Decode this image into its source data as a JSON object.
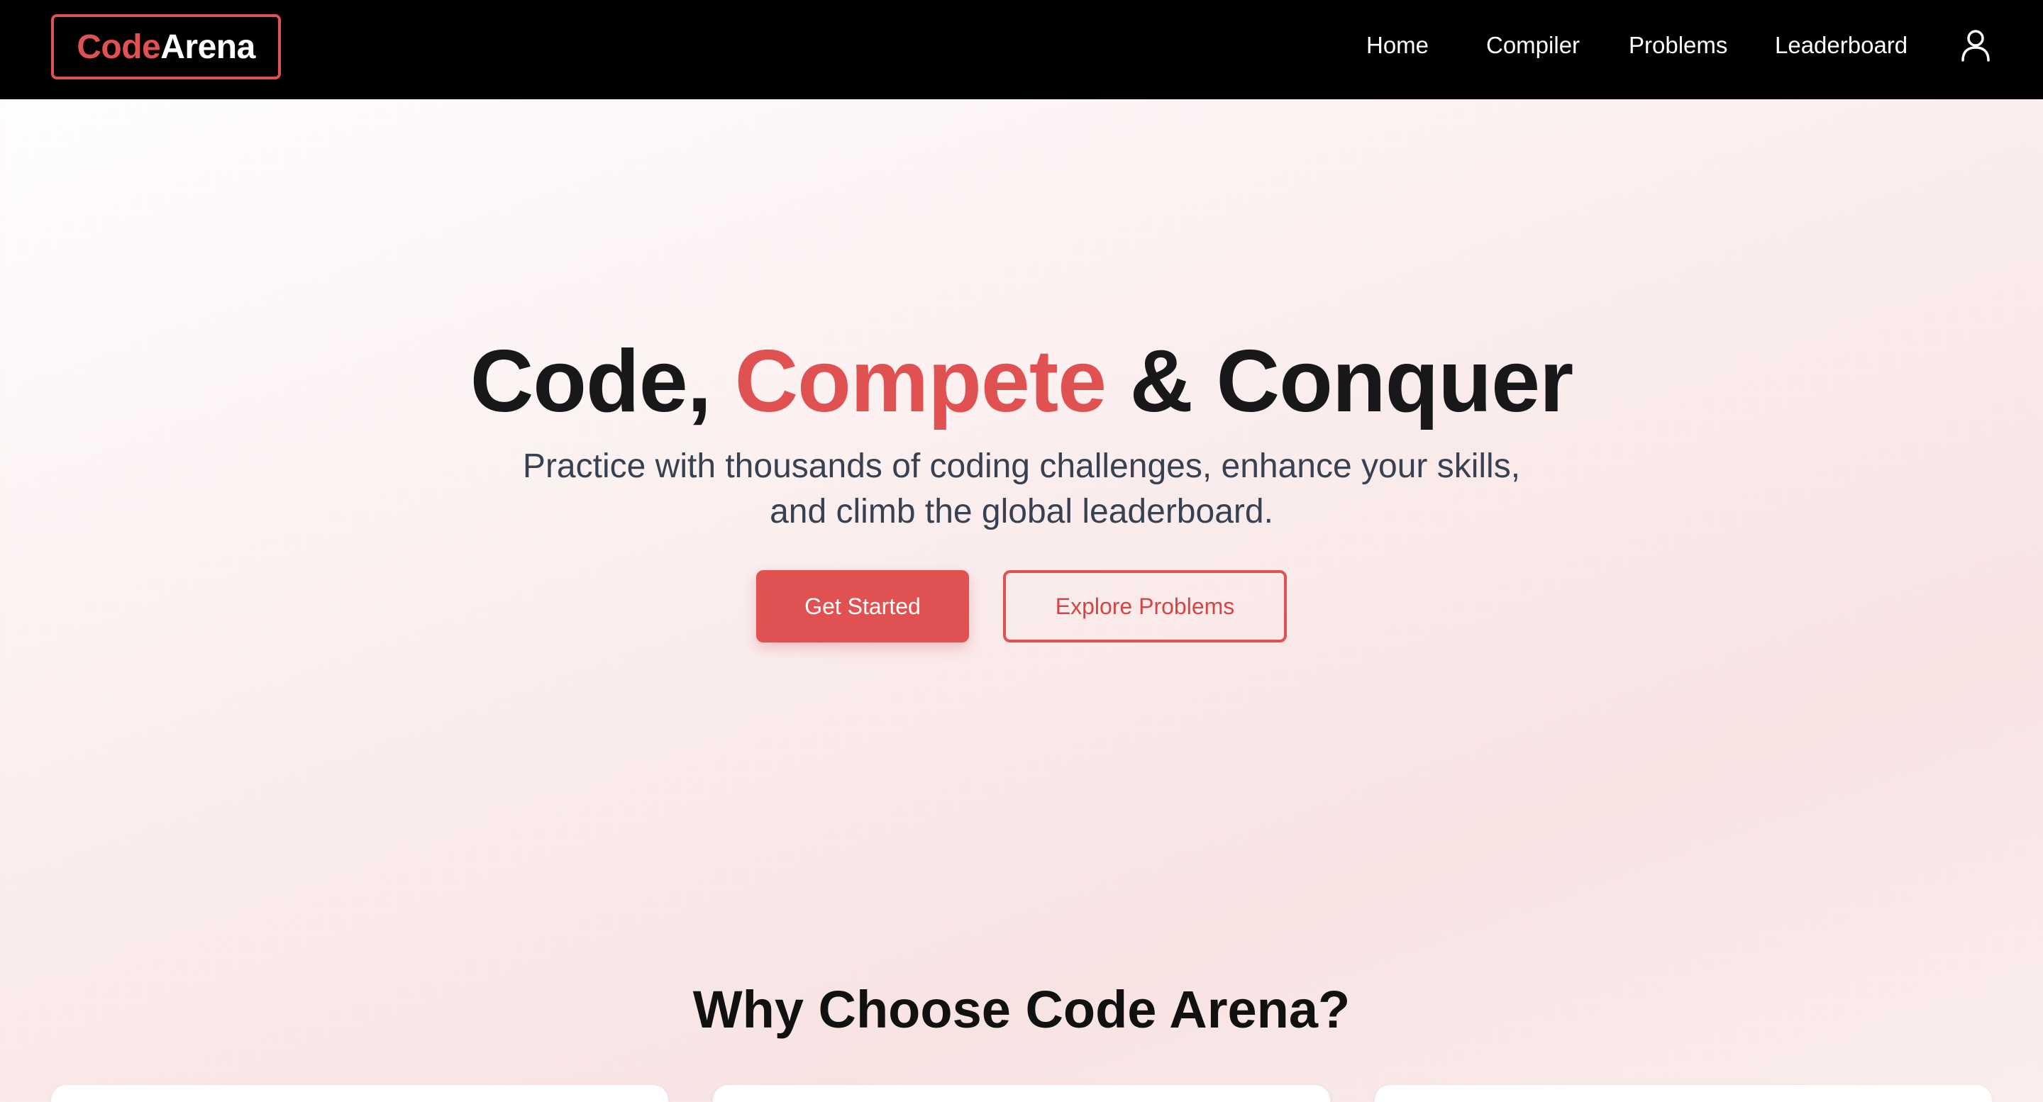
{
  "brand": {
    "logo_part1": "Code",
    "logo_part2": "Arena",
    "accent_color": "#e05252"
  },
  "nav": {
    "items": [
      {
        "label": "Home"
      },
      {
        "label": "Compiler"
      },
      {
        "label": "Problems"
      },
      {
        "label": "Leaderboard"
      }
    ],
    "profile_icon": "user-icon"
  },
  "hero": {
    "title_part1": "Code, ",
    "title_accent": "Compete",
    "title_part2": " & Conquer",
    "subtitle_line1": "Practice with thousands of coding challenges, enhance your skills,",
    "subtitle_line2": "and climb the global leaderboard.",
    "primary_button": "Get Started",
    "secondary_button": "Explore Problems"
  },
  "features": {
    "title": "Why Choose Code Arena?",
    "cards": [
      {},
      {},
      {}
    ]
  }
}
